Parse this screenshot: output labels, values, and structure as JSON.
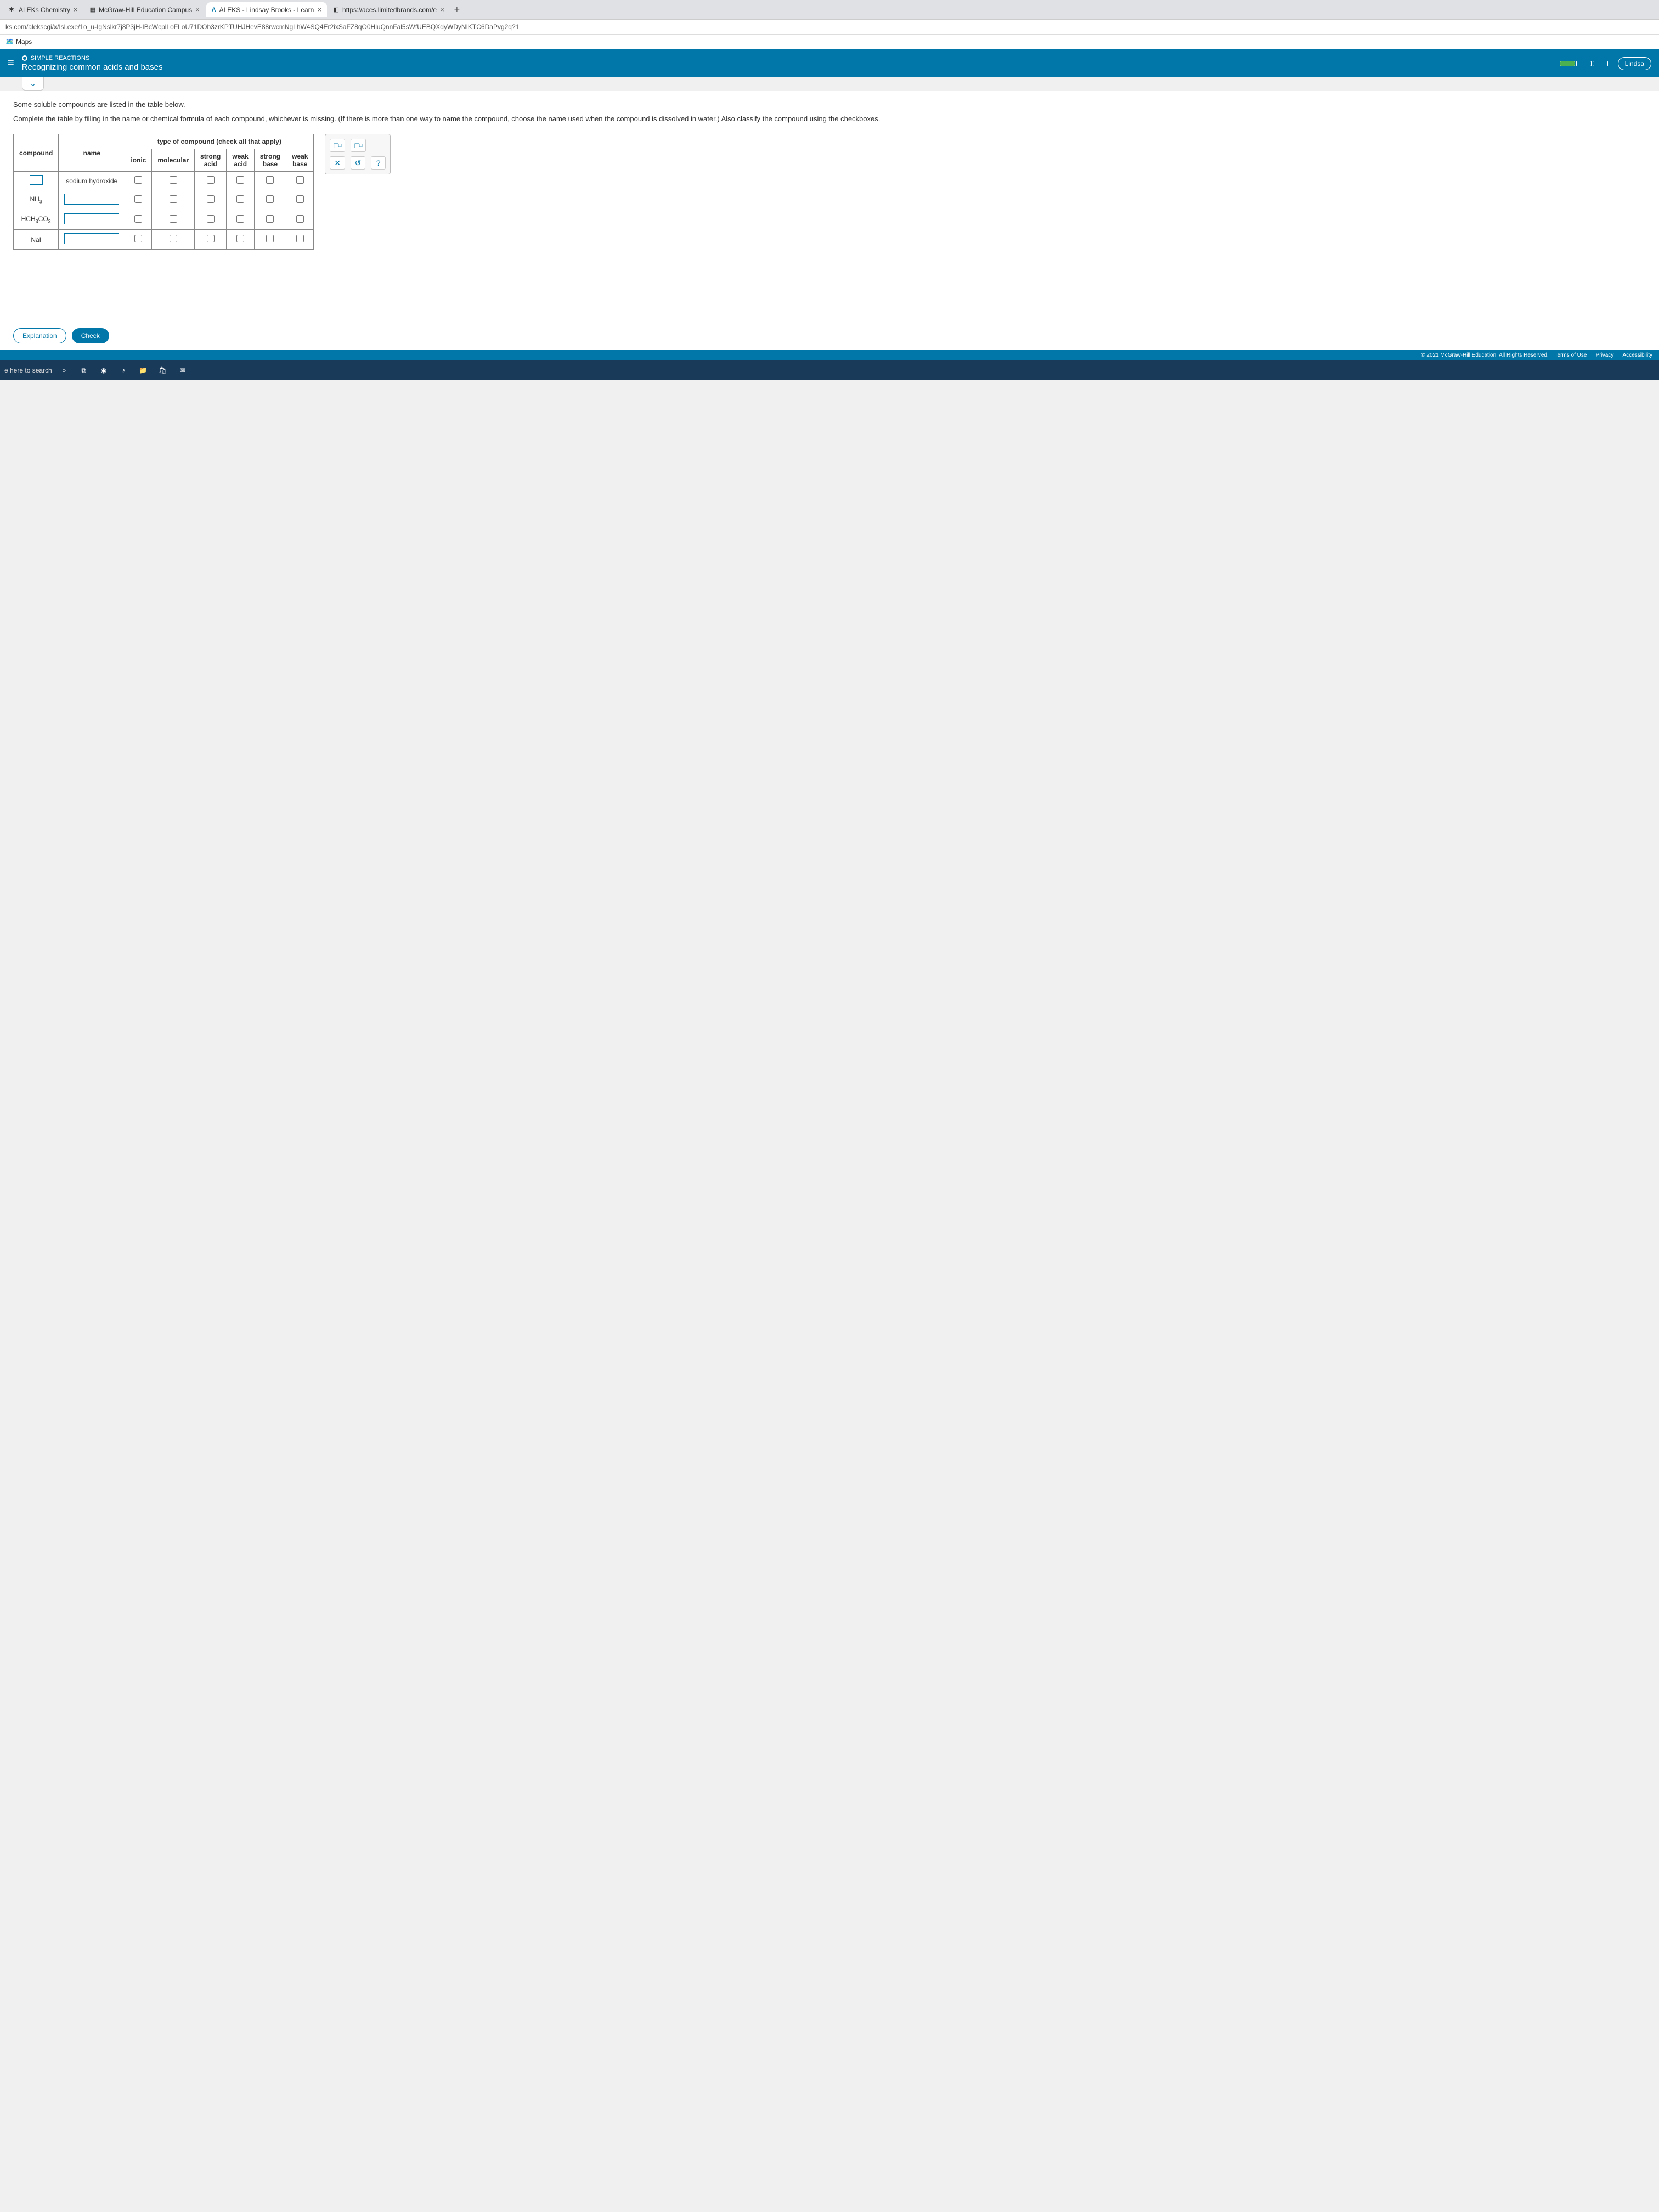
{
  "tabs": [
    {
      "label": "ALEKs Chemistry",
      "icon": "✱"
    },
    {
      "label": "McGraw-Hill Education Campus",
      "icon": "▦"
    },
    {
      "label": "ALEKS - Lindsay Brooks - Learn",
      "icon": "A"
    },
    {
      "label": "https://aces.limitedbrands.com/e",
      "icon": "◧"
    }
  ],
  "url": "ks.com/alekscgi/x/Isl.exe/1o_u-IgNslkr7j8P3jH-IBcWcplLoFLoU71DOb3zrKPTUHJHevE88rwcmNgLhW4SQ4Er2ixSaFZ8qO0HluQnnFal5sWfUEBQXdyWDyNIKTC6DaPvg2q?1",
  "bookmark": {
    "label": "Maps"
  },
  "header": {
    "category": "SIMPLE REACTIONS",
    "title": "Recognizing common acids and bases",
    "user": "Lindsa"
  },
  "intro": {
    "line1": "Some soluble compounds are listed in the table below.",
    "line2": "Complete the table by filling in the name or chemical formula of each compound, whichever is missing. (If there is more than one way to name the compound, choose the name used when the compound is dissolved in water.) Also classify the compound using the checkboxes."
  },
  "table": {
    "headers": {
      "compound": "compound",
      "name": "name",
      "type_group": "type of compound (check all that apply)",
      "cols": [
        "ionic",
        "molecular",
        "strong acid",
        "weak acid",
        "strong base",
        "weak base"
      ]
    },
    "rows": [
      {
        "compound": "",
        "name": "sodium hydroxide",
        "compound_is_input": true,
        "name_is_input": false
      },
      {
        "compound": "NH₃",
        "name": "",
        "compound_is_input": false,
        "name_is_input": true
      },
      {
        "compound": "HCH₃CO₂",
        "name": "",
        "compound_is_input": false,
        "name_is_input": true
      },
      {
        "compound": "NaI",
        "name": "",
        "compound_is_input": false,
        "name_is_input": true
      }
    ]
  },
  "palette": {
    "sub_btn": "□▫",
    "sup_btn": "□▫",
    "close": "✕",
    "reset": "↺",
    "help": "?"
  },
  "buttons": {
    "explanation": "Explanation",
    "check": "Check"
  },
  "footer": {
    "copyright": "© 2021 McGraw-Hill Education. All Rights Reserved.",
    "links": [
      "Terms of Use",
      "Privacy",
      "Accessibility"
    ]
  },
  "taskbar": {
    "search": "e here to search"
  }
}
